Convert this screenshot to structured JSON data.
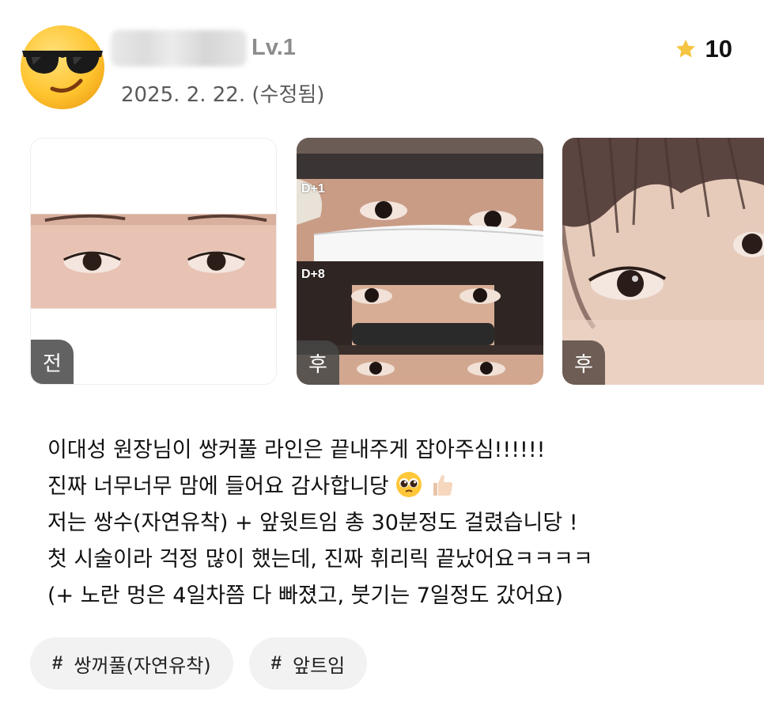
{
  "header": {
    "avatar_icon": "sunglasses-emoji-icon",
    "level": "Lv.1",
    "date": "2025. 2. 22. (수정됨)",
    "rating": {
      "icon": "star-icon",
      "value": "10",
      "star_color": "#F5C542"
    }
  },
  "photos": [
    {
      "badge": "전",
      "day_labels": []
    },
    {
      "badge": "후",
      "day_labels": [
        "D+1",
        "D+8"
      ]
    },
    {
      "badge": "후",
      "day_labels": []
    }
  ],
  "review": {
    "lines": [
      "이대성 원장님이 쌍커풀 라인은 끝내주게 잡아주심!!!!!!",
      "진짜 너무너무 맘에 들어요 감사합니당",
      "저는 쌍수(자연유착) + 앞윗트임 총 30분정도 걸렸습니당 !",
      "첫 시술이라 걱정 많이 했는데, 진짜 휘리릭 끝났어요ㅋㅋㅋㅋ",
      "(+ 노란 멍은 4일차쯤 다 빠졌고, 붓기는 7일정도 갔어요)"
    ],
    "line2_emojis": [
      "pleading-face-icon",
      "thumbs-up-icon"
    ]
  },
  "tags": [
    {
      "hash": "#",
      "label": "쌍꺼풀(자연유착)"
    },
    {
      "hash": "#",
      "label": "앞트임"
    }
  ]
}
